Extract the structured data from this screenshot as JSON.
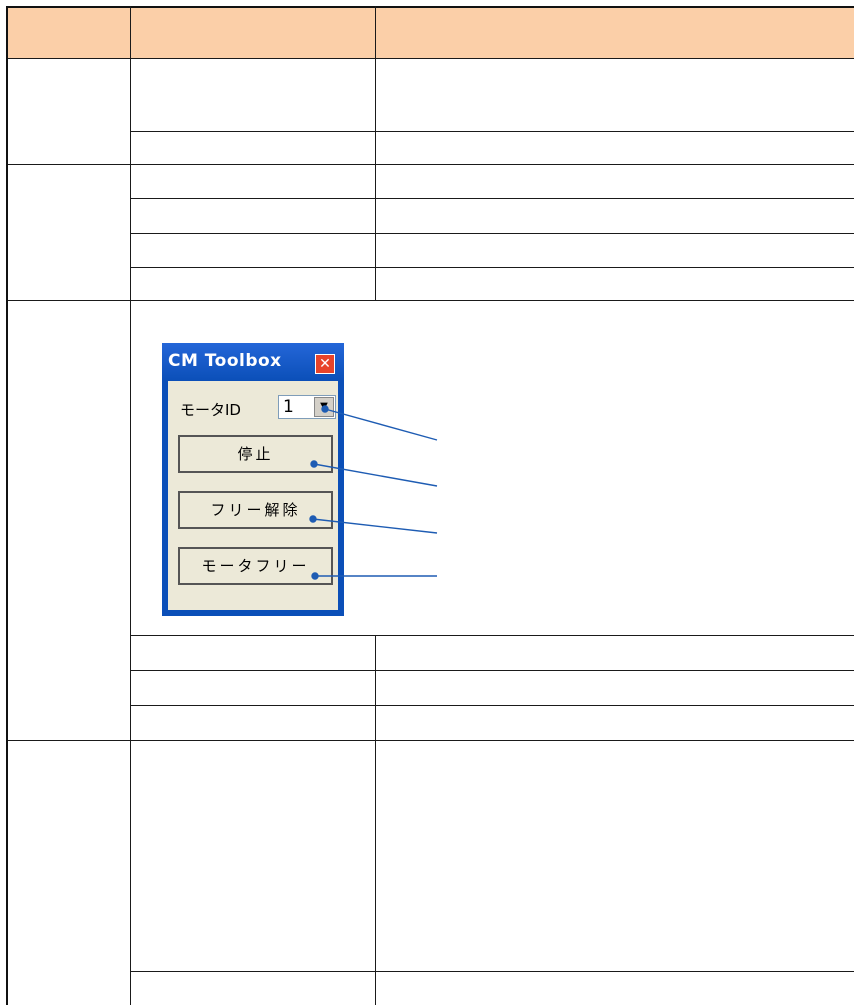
{
  "toolbox": {
    "title": "CM Toolbox",
    "close_glyph": "✕",
    "motor_id_label": "モータID",
    "motor_id_value": "1",
    "dropdown_glyph": "▼",
    "buttons": {
      "stop": "停止",
      "free_release": "フリー解除",
      "motor_free": "モータフリー"
    }
  },
  "colors": {
    "header_fill": "#fbcfa8",
    "window_frame": "#0b4fb8",
    "callout_line": "#1e5cb3"
  },
  "icons": {
    "close": "close-icon",
    "dropdown": "chevron-down-icon"
  }
}
